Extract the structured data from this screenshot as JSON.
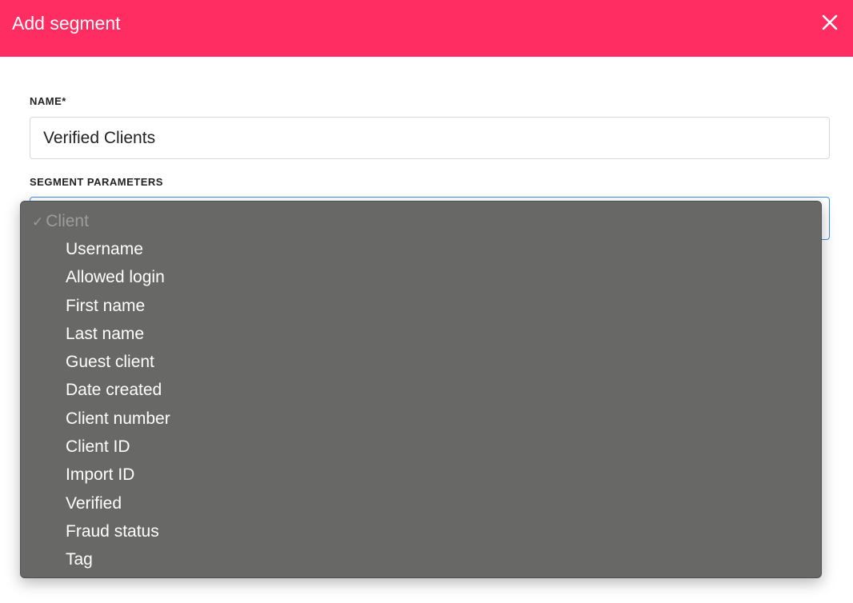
{
  "modal": {
    "title": "Add segment",
    "header_color": "#ff2d62"
  },
  "form": {
    "name_label": "NAME*",
    "name_value": "Verified Clients",
    "params_label": "SEGMENT PARAMETERS"
  },
  "dropdown": {
    "group_checkmark": "✓",
    "group_label": "Client",
    "options": [
      "Username",
      "Allowed login",
      "First name",
      "Last name",
      "Guest client",
      "Date created",
      "Client number",
      "Client ID",
      "Import ID",
      "Verified",
      "Fraud status",
      "Tag"
    ]
  },
  "icons": {
    "close": "close-icon",
    "check": "checkmark-icon"
  }
}
